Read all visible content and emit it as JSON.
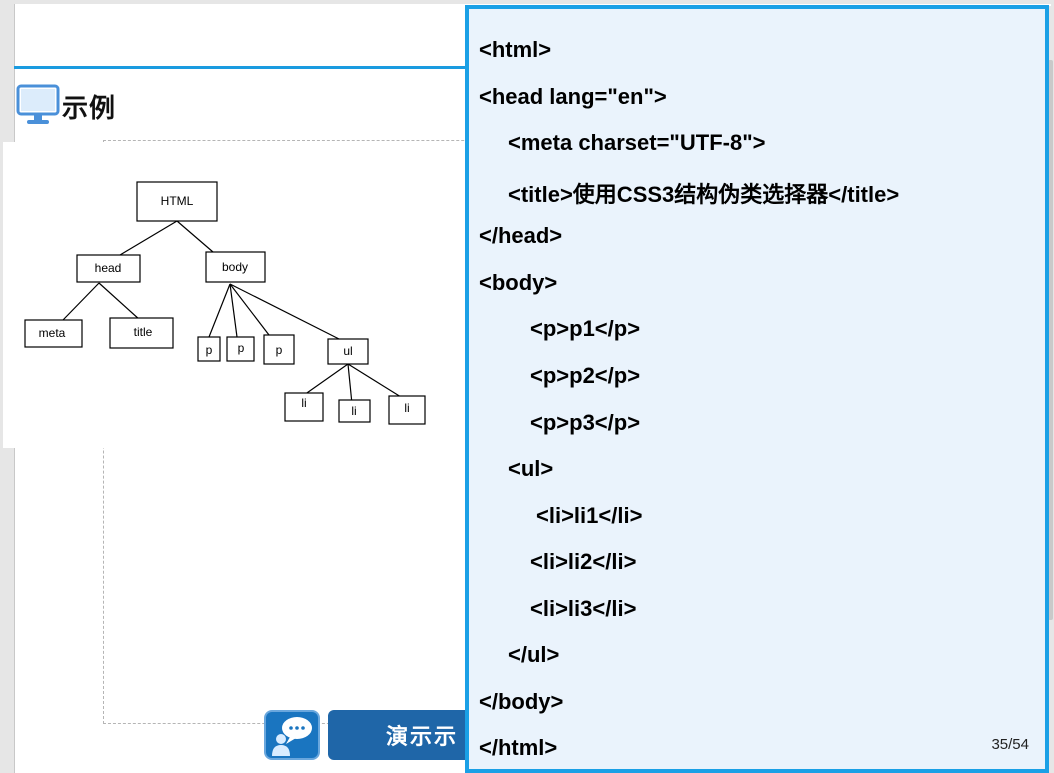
{
  "heading": {
    "text": "示例",
    "icon": "monitor-icon"
  },
  "tree": {
    "nodes": {
      "html": "HTML",
      "head": "head",
      "body": "body",
      "meta": "meta",
      "title": "title",
      "p1": "p",
      "p2": "p",
      "p3": "p",
      "ul": "ul",
      "li1": "li",
      "li2": "li",
      "li3": "li"
    }
  },
  "demo": {
    "label": "演示示",
    "icon": "speech-bubble-icon"
  },
  "code": {
    "lines": [
      "<html>",
      "<head lang=\"en\">",
      "<meta charset=\"UTF-8\">",
      "<title>使用CSS3结构伪类选择器</title>",
      "</head>",
      "<body>",
      "<p>p1</p>",
      "<p>p2</p>",
      "<p>p3</p>",
      "<ul>",
      "<li>li1</li>",
      "<li>li2</li>",
      "<li>li3</li>",
      "</ul>",
      "</body>",
      "</html>"
    ]
  },
  "page_indicator": "35/54",
  "colors": {
    "accent": "#1aa0e6",
    "code_bg": "#eaf3fc",
    "demo_button": "#1f66a8"
  }
}
